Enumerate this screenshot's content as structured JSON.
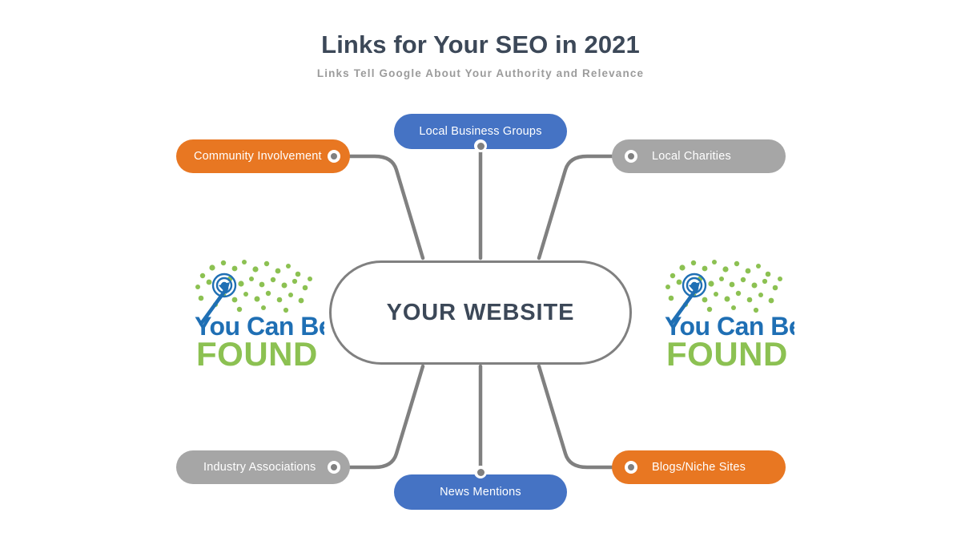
{
  "header": {
    "title": "Links for Your SEO in 2021",
    "subtitle": "Links Tell Google About Your Authority and Relevance"
  },
  "center": {
    "label": "YOUR WEBSITE"
  },
  "nodes": [
    {
      "id": "community-involvement",
      "label": "Community Involvement",
      "color": "#E87722",
      "position": "top-left"
    },
    {
      "id": "local-business-groups",
      "label": "Local Business Groups",
      "color": "#4573C4",
      "position": "top-center"
    },
    {
      "id": "local-charities",
      "label": "Local Charities",
      "color": "#A6A6A6",
      "position": "top-right"
    },
    {
      "id": "industry-associations",
      "label": "Industry Associations",
      "color": "#A6A6A6",
      "position": "bottom-left"
    },
    {
      "id": "news-mentions",
      "label": "News Mentions",
      "color": "#4573C4",
      "position": "bottom-center"
    },
    {
      "id": "blogs-niche-sites",
      "label": "Blogs/Niche Sites",
      "color": "#E87722",
      "position": "bottom-right"
    }
  ],
  "logo": {
    "line1": "You Can Be",
    "line2": "FOUND",
    "line1_color": "#1F6FB4",
    "line2_color": "#8CC152",
    "icon": "target-arrow-icon"
  },
  "colors": {
    "background": "#FFFFFF",
    "title": "#3C4858",
    "subtitle": "#9B9B9B",
    "connector": "#808080",
    "orange": "#E87722",
    "blue": "#4573C4",
    "gray": "#A6A6A6"
  }
}
